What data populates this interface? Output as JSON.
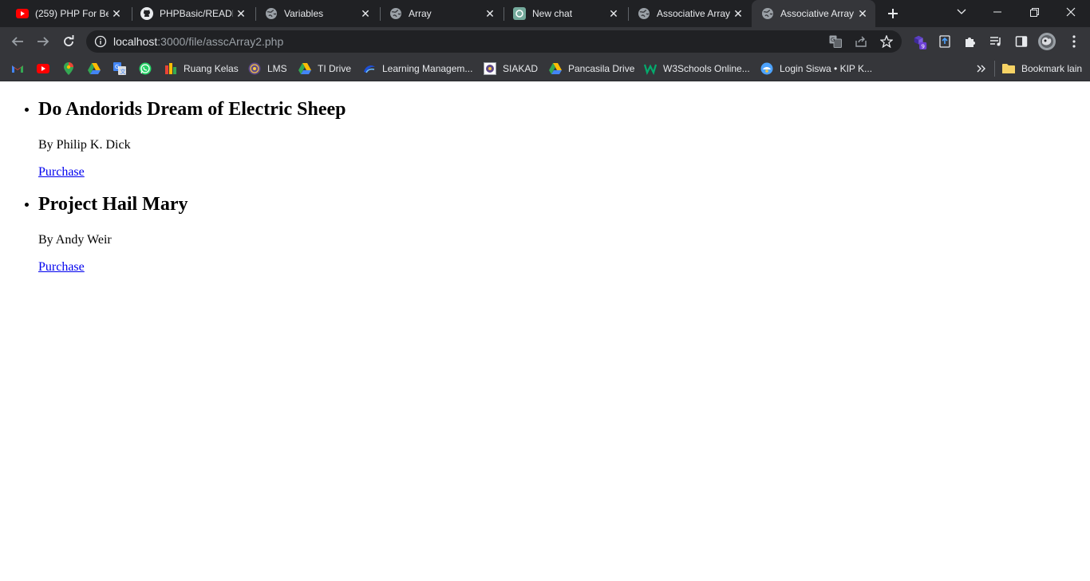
{
  "browser": {
    "tabs": [
      {
        "title": "(259) PHP For Beginners",
        "favicon": "youtube-icon",
        "active": false
      },
      {
        "title": "PHPBasic/README",
        "favicon": "github-icon",
        "active": false
      },
      {
        "title": "Variables",
        "favicon": "globe-icon",
        "active": false
      },
      {
        "title": "Array",
        "favicon": "globe-icon",
        "active": false
      },
      {
        "title": "New chat",
        "favicon": "chatgpt-icon",
        "active": false
      },
      {
        "title": "Associative Array",
        "favicon": "globe-icon",
        "active": false
      },
      {
        "title": "Associative Array",
        "favicon": "globe-icon",
        "active": true
      }
    ],
    "address": {
      "host": "localhost",
      "rest": ":3000/file/asscArray2.php"
    },
    "extension_badge": "9",
    "bookmarks": [
      {
        "label": "",
        "icon": "gmail-icon"
      },
      {
        "label": "",
        "icon": "youtube-icon"
      },
      {
        "label": "",
        "icon": "maps-icon"
      },
      {
        "label": "",
        "icon": "drive-icon"
      },
      {
        "label": "",
        "icon": "translate-icon"
      },
      {
        "label": "",
        "icon": "whatsapp-icon"
      },
      {
        "label": "Ruang Kelas",
        "icon": "classroom-icon"
      },
      {
        "label": "LMS",
        "icon": "university-logo-icon"
      },
      {
        "label": "TI Drive",
        "icon": "drive-icon"
      },
      {
        "label": "Learning Managem...",
        "icon": "learning-icon"
      },
      {
        "label": "SIAKAD",
        "icon": "siakad-icon"
      },
      {
        "label": "Pancasila Drive",
        "icon": "drive-icon"
      },
      {
        "label": "W3Schools Online...",
        "icon": "w3schools-icon"
      },
      {
        "label": "Login Siswa • KIP K...",
        "icon": "kip-icon"
      }
    ],
    "other_bookmarks_label": "Bookmark lain"
  },
  "page": {
    "books": [
      {
        "title": "Do Andorids Dream of Electric Sheep",
        "author_line": "By Philip K. Dick",
        "link_label": "Purchase"
      },
      {
        "title": "Project Hail Mary",
        "author_line": "By Andy Weir",
        "link_label": "Purchase"
      }
    ]
  },
  "colors": {
    "tabstrip_bg": "#202124",
    "toolbar_bg": "#35363a",
    "link": "#0000ee"
  }
}
